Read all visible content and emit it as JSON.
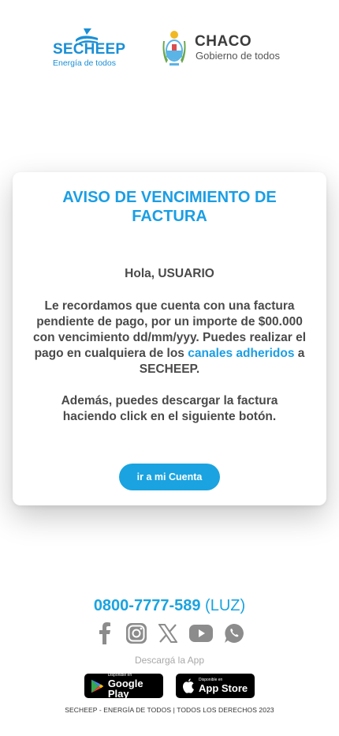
{
  "header": {
    "secheep_name": "SECHEEP",
    "secheep_tagline": "Energía de todos",
    "chaco_name": "CHACO",
    "chaco_subtitle": "Gobierno de todos"
  },
  "notice": {
    "title": "AVISO DE VENCIMIENTO DE FACTURA",
    "greeting": "Hola, USUARIO",
    "message_before": "Le recordamos que cuenta con una factura pendiente de pago, por un importe de $00.000 con vencimiento dd/mm/yyy. Puedes realizar el pago en cualquiera de los ",
    "message_link": "canales adheridos",
    "message_after": " a SECHEEP.",
    "message2": "Además, puedes descargar la factura haciendo click en el siguiente botón.",
    "button_label": "ir a mi Cuenta"
  },
  "footer": {
    "phone_number": "0800-7777-589",
    "phone_suffix": " (LUZ)",
    "social_icons": [
      "facebook-icon",
      "instagram-icon",
      "x-icon",
      "youtube-icon",
      "whatsapp-icon"
    ],
    "download_label": "Descargá la App",
    "google_play_small": "Disponible en",
    "google_play_big": "Google Play",
    "app_store_small": "Disponible en",
    "app_store_big": "App Store",
    "copyright": "SECHEEP - ENERGÍA DE TODOS | TODOS LOS DERECHOS 2023"
  },
  "colors": {
    "accent": "#1aa3e0",
    "secheep_blue": "#1a8fd6",
    "icon_gray": "#8c8c8c",
    "text": "#4a4a4a"
  }
}
